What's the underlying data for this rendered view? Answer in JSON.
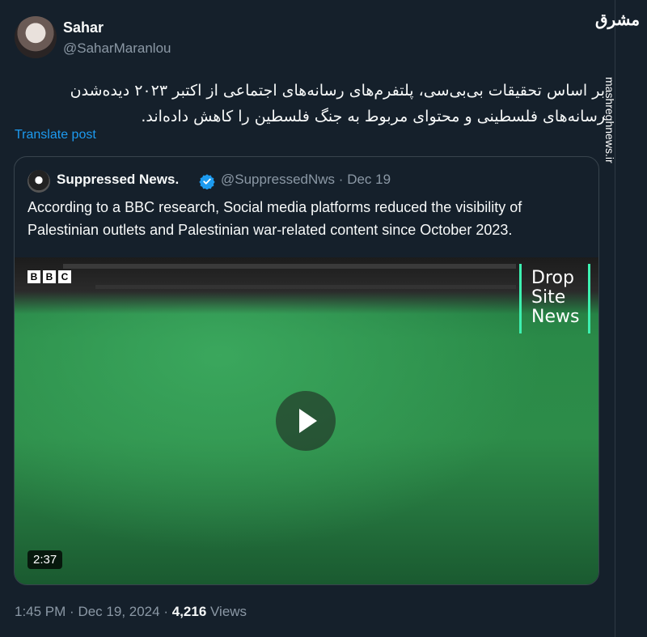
{
  "author": {
    "name": "Sahar",
    "handle": "@SaharMaranlou"
  },
  "tweet": {
    "line1": "بر اساس تحقیقات بی‌بی‌سی، پلتفرم‌های رسانه‌های اجتماعی از اکتبر ۲۰۲۳ دیده‌شدن",
    "line2": "رسانه‌های فلسطینی و محتوای مربوط به جنگ فلسطین را کاهش داده‌اند.",
    "translate_label": "Translate post"
  },
  "quote": {
    "name": "Suppressed News.",
    "handle": "@SuppressedNws",
    "separator": "·",
    "date": "Dec 19",
    "text": "According to a BBC research, Social media platforms reduced the visibility of Palestinian outlets and Palestinian war-related content since October 2023.",
    "video": {
      "bbc_letters": [
        "B",
        "B",
        "C"
      ],
      "logo_lines": [
        "Drop",
        "Site",
        "News"
      ],
      "duration": "2:37"
    }
  },
  "meta": {
    "time": "1:45 PM",
    "separator": "·",
    "date": "Dec 19, 2024",
    "views_count": "4,216",
    "views_label": "Views"
  },
  "watermark": {
    "logo_text": "مشرق",
    "url": "mashreghnews.ir"
  },
  "colors": {
    "background": "#15202b",
    "link": "#1d9bf0",
    "secondary_text": "#8b98a5",
    "verified": "#1d9bf0"
  }
}
